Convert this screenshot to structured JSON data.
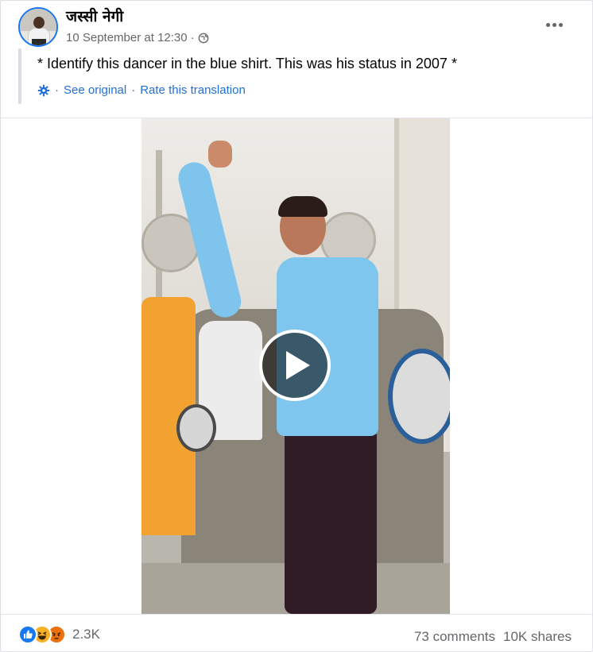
{
  "post": {
    "author": "जस्सी नेगी",
    "timestamp": "10 September at 12:30",
    "separator": "·",
    "privacy_icon": "globe-icon",
    "options_icon": "more-options-icon",
    "text": "* Identify this dancer in the blue shirt. This was his status in 2007 *",
    "translation": {
      "icon": "gear-icon",
      "see_original": "See original",
      "dot": "·",
      "rate": "Rate this translation"
    }
  },
  "video": {
    "play_icon": "play-icon"
  },
  "footer": {
    "reactions": [
      "like-icon",
      "haha-icon",
      "angry-icon"
    ],
    "reaction_count": "2.3K",
    "comments": "73 comments",
    "shares": "10K shares"
  },
  "colors": {
    "link_blue": "#216fdb",
    "secondary_text": "#65676b",
    "like_blue": "#1877f2",
    "haha_yellow": "#f7b125",
    "angry_orange": "#e9710f"
  }
}
